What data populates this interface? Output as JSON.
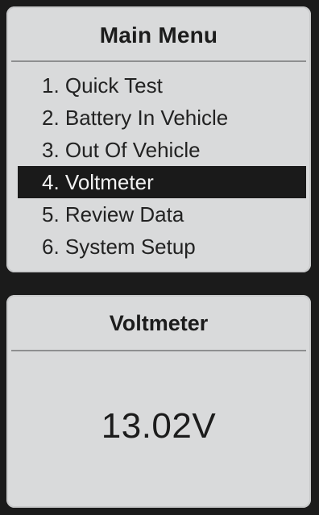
{
  "main_menu": {
    "title": "Main Menu",
    "items": [
      {
        "label": "1. Quick Test",
        "selected": false
      },
      {
        "label": "2. Battery In Vehicle",
        "selected": false
      },
      {
        "label": "3. Out Of Vehicle",
        "selected": false
      },
      {
        "label": "4. Voltmeter",
        "selected": true
      },
      {
        "label": "5. Review Data",
        "selected": false
      },
      {
        "label": "6. System Setup",
        "selected": false
      }
    ]
  },
  "voltmeter": {
    "title": "Voltmeter",
    "reading": "13.02V"
  },
  "colors": {
    "screen_bg": "#d9dadb",
    "bezel": "#1b1b1b",
    "selection_bg": "#1a1a1a",
    "selection_text": "#f2f2f2",
    "text": "#1c1c1c"
  }
}
